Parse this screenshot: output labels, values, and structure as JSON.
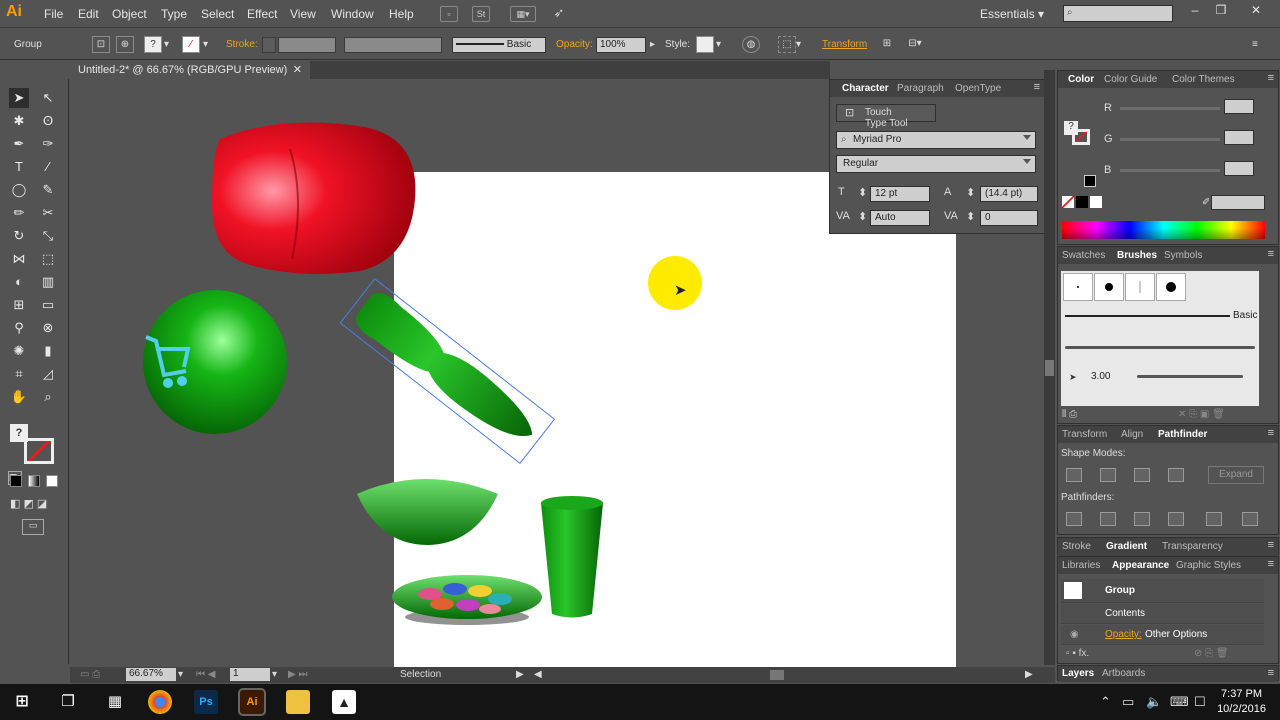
{
  "app": {
    "logo": "Ai",
    "workspace": "Essentials"
  },
  "menu": [
    "File",
    "Edit",
    "Object",
    "Type",
    "Select",
    "Effect",
    "View",
    "Window",
    "Help"
  ],
  "control": {
    "selection_label": "Group",
    "stroke_label": "Stroke:",
    "stroke_style": "Basic",
    "opacity_label": "Opacity:",
    "opacity_value": "100%",
    "style_label": "Style:",
    "transform_label": "Transform"
  },
  "document": {
    "tab_title": "Untitled-2* @ 66.67% (RGB/GPU Preview)"
  },
  "character": {
    "tabs": [
      "Character",
      "Paragraph",
      "OpenType"
    ],
    "touch_type": "Touch Type Tool",
    "font": "Myriad Pro",
    "style": "Regular",
    "size": "12 pt",
    "leading": "(14.4 pt)",
    "kerning": "Auto",
    "tracking": "0"
  },
  "color": {
    "tabs": [
      "Color",
      "Color Guide",
      "Color Themes"
    ],
    "channels": [
      "R",
      "G",
      "B"
    ]
  },
  "brushes": {
    "tabs": [
      "Swatches",
      "Brushes",
      "Symbols"
    ],
    "basic_label": "Basic",
    "size_label": "3.00"
  },
  "pathfinder": {
    "tabs": [
      "Transform",
      "Align",
      "Pathfinder"
    ],
    "shape_modes": "Shape Modes:",
    "pathfinders": "Pathfinders:",
    "expand": "Expand"
  },
  "gradient": {
    "tabs": [
      "Stroke",
      "Gradient",
      "Transparency"
    ]
  },
  "appearance": {
    "tabs": [
      "Libraries",
      "Appearance",
      "Graphic Styles"
    ],
    "group": "Group",
    "contents": "Contents",
    "opacity_label": "Opacity:",
    "opacity_value": "Other Options"
  },
  "layers": {
    "tabs": [
      "Layers",
      "Artboards"
    ]
  },
  "status": {
    "zoom": "66.67%",
    "page": "1",
    "tool": "Selection"
  },
  "taskbar": {
    "time": "7:37 PM",
    "date": "10/2/2016"
  }
}
